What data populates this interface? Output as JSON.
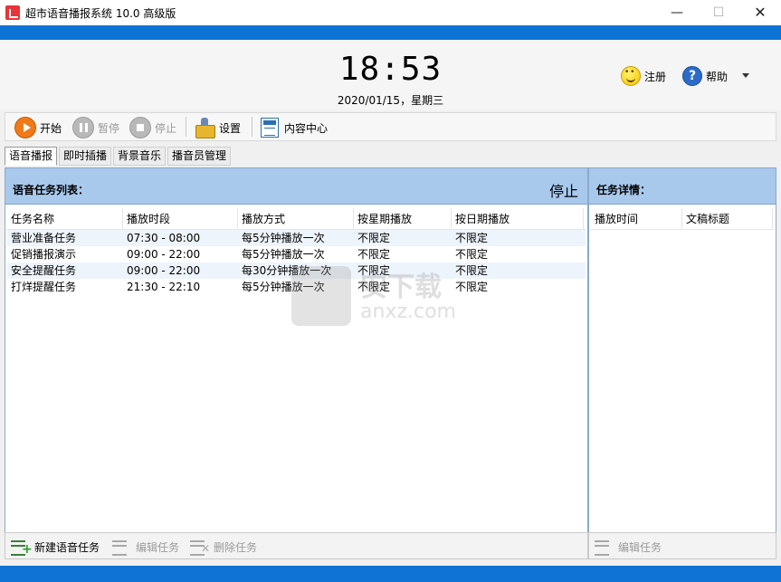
{
  "window": {
    "title": "超市语音播报系统 10.0 高级版",
    "min": "—",
    "max": "☐",
    "close": "✕"
  },
  "header": {
    "clock": "18:53",
    "date": "2020/01/15，星期三",
    "register_label": "注册",
    "help_label": "帮助",
    "help_glyph": "?"
  },
  "toolbar": {
    "start_label": "开始",
    "pause_label": "暂停",
    "stop_label": "停止",
    "settings_label": "设置",
    "content_center_label": "内容中心"
  },
  "tabs": [
    "语音播报",
    "即时插播",
    "背景音乐",
    "播音员管理"
  ],
  "task_panel": {
    "title": "语音任务列表：",
    "status": "停止",
    "columns": [
      "任务名称",
      "播放时段",
      "播放方式",
      "按星期播放",
      "按日期播放"
    ],
    "rows": [
      [
        "营业准备任务",
        "07:30 - 08:00",
        "每5分钟播放一次",
        "不限定",
        "不限定"
      ],
      [
        "促销播报演示",
        "09:00 - 22:00",
        "每5分钟播放一次",
        "不限定",
        "不限定"
      ],
      [
        "安全提醒任务",
        "09:00 - 22:00",
        "每30分钟播放一次",
        "不限定",
        "不限定"
      ],
      [
        "打烊提醒任务",
        "21:30 - 22:10",
        "每5分钟播放一次",
        "不限定",
        "不限定"
      ]
    ]
  },
  "detail_panel": {
    "title": "任务详情：",
    "columns": [
      "播放时间",
      "文稿标题"
    ]
  },
  "watermark": {
    "text": "安下载",
    "sub": "anxz.com"
  },
  "footer": {
    "new_task_label": "新建语音任务",
    "edit_task_label": "编辑任务",
    "delete_task_label": "删除任务",
    "detail_edit_label": "编辑任务"
  },
  "colors": {
    "accent_blue": "#0d74d6",
    "panel_header": "#a9c9ec",
    "play_orange": "#f07a1a"
  }
}
